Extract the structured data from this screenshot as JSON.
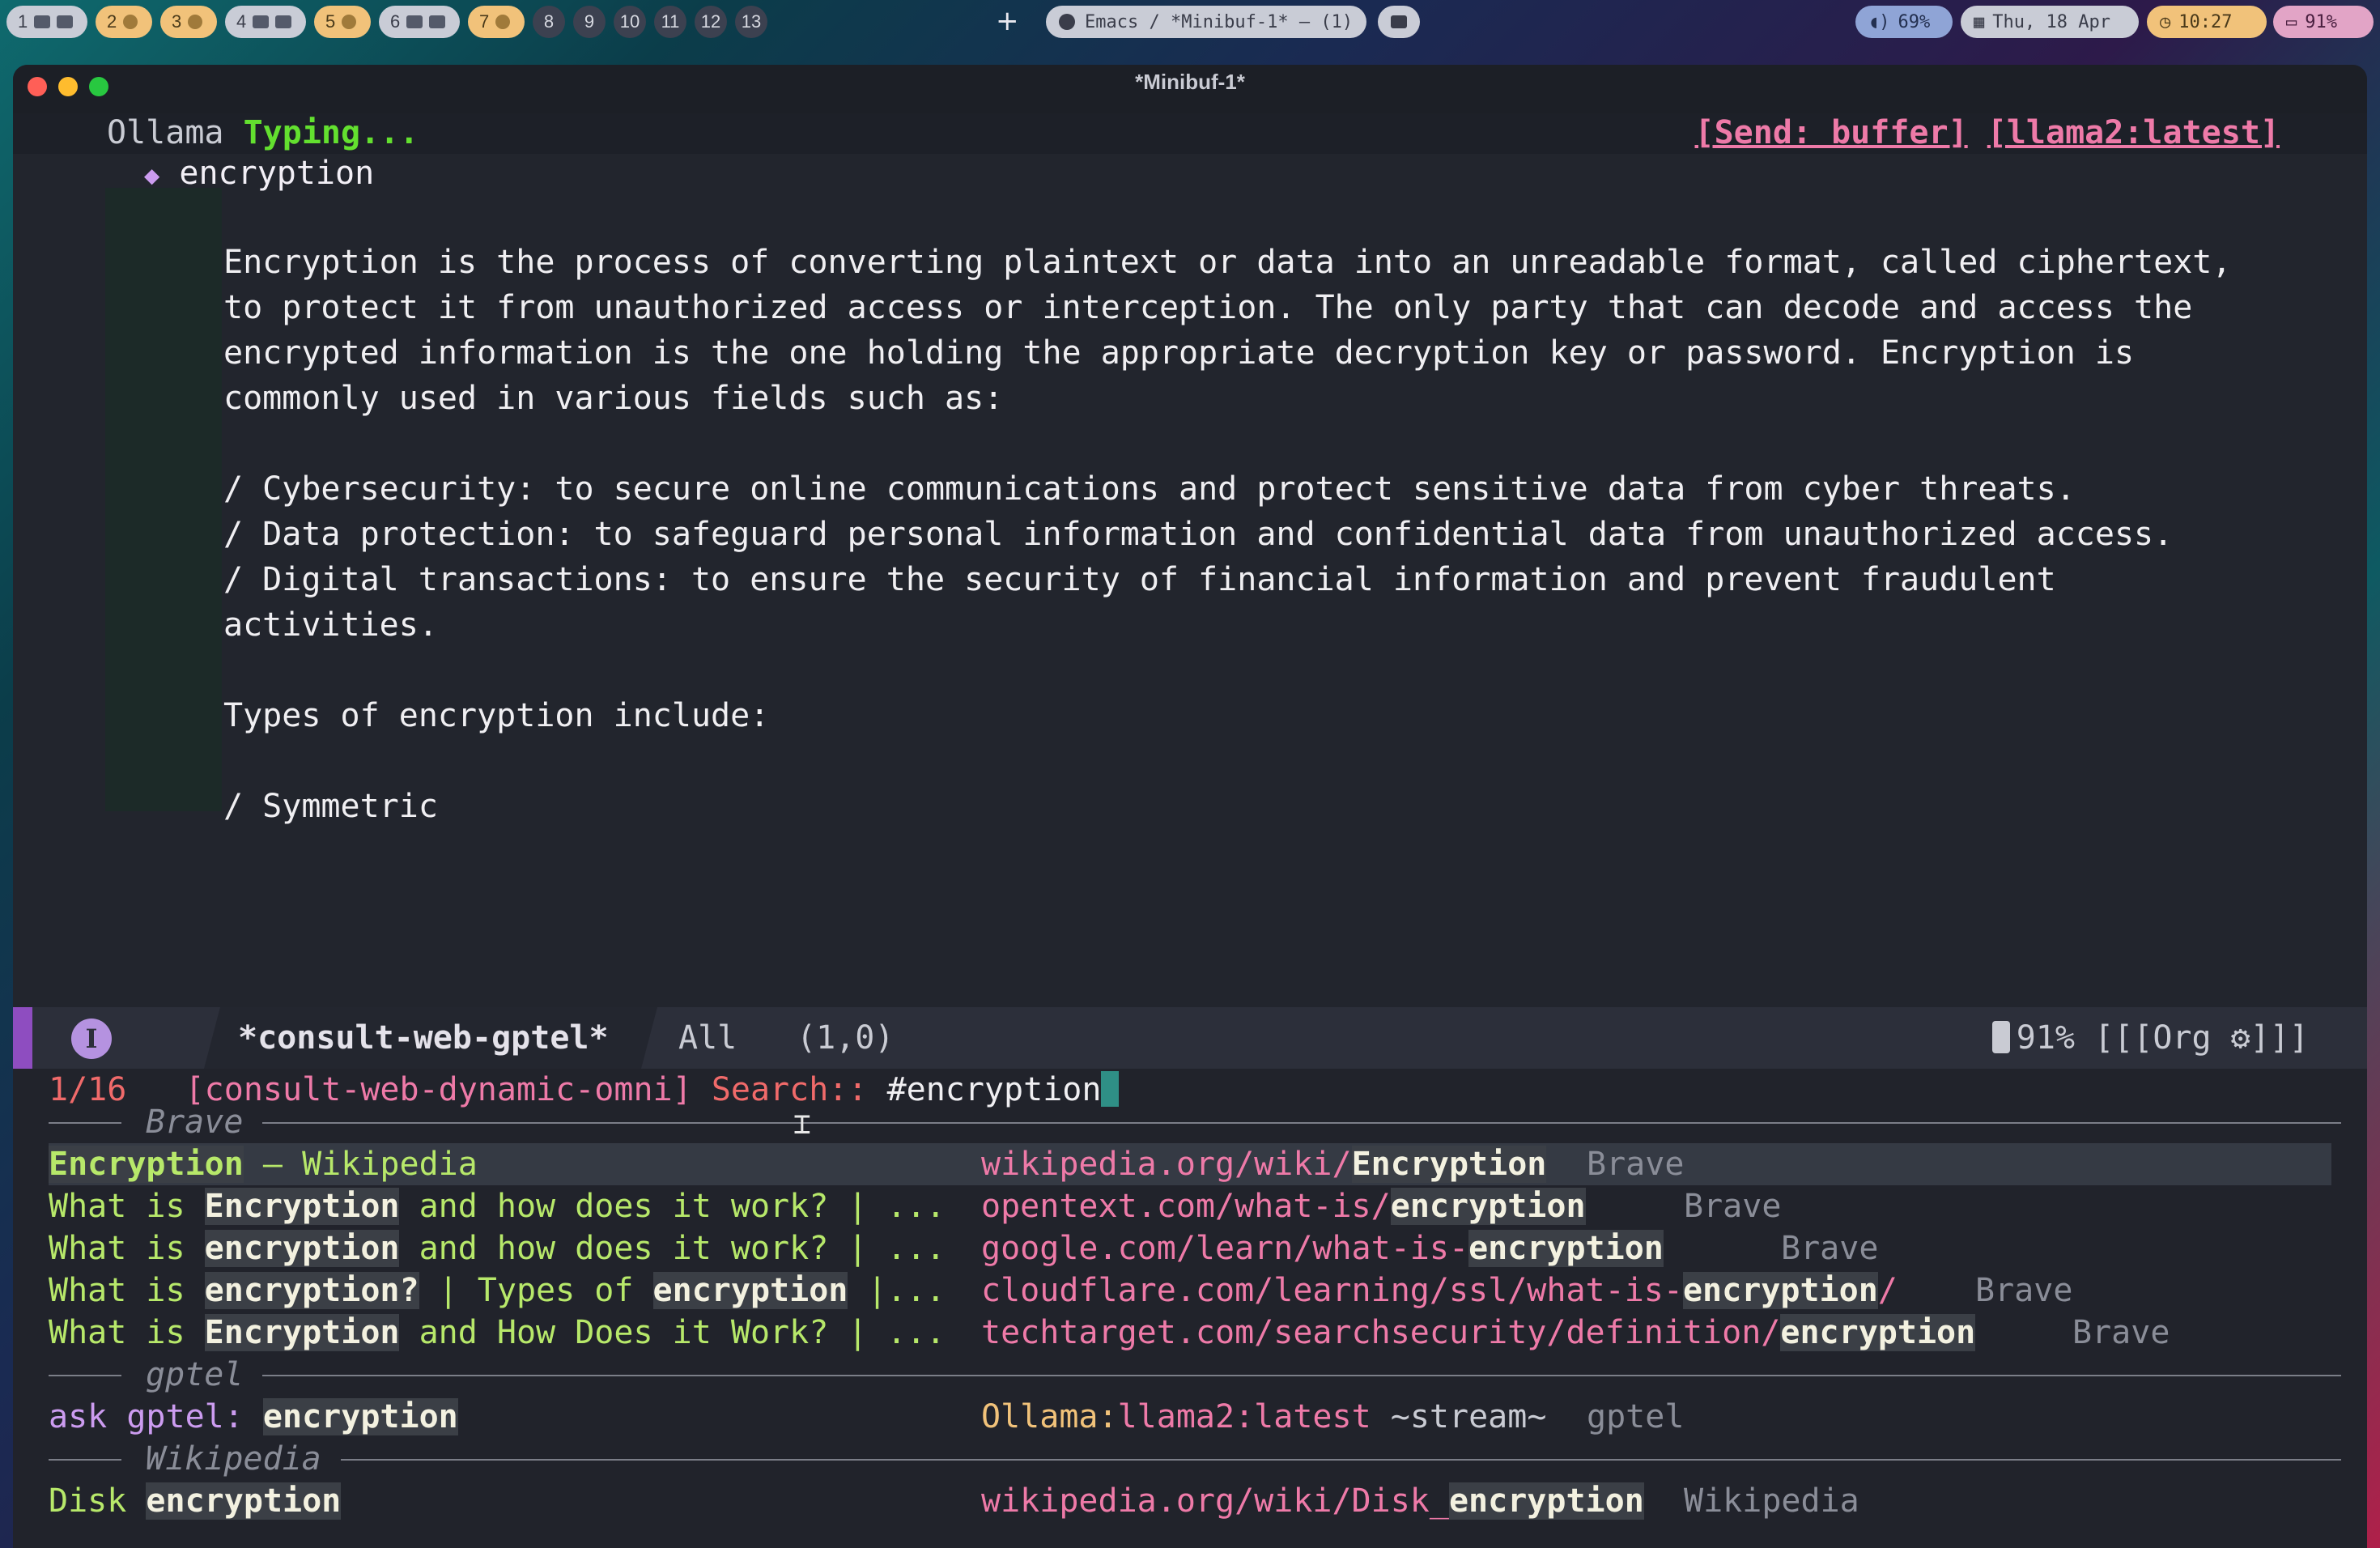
{
  "topbar": {
    "workspaces": [
      {
        "num": "1",
        "icons": [
          "terminal-icon",
          "window-icon"
        ],
        "active": false
      },
      {
        "num": "2",
        "icons": [
          "user-icon"
        ],
        "active": true
      },
      {
        "num": "3",
        "icons": [
          "window-icon"
        ],
        "active": true
      },
      {
        "num": "4",
        "icons": [
          "window-icon",
          "globe-icon"
        ],
        "active": false
      },
      {
        "num": "5",
        "icons": [
          "chat-icon"
        ],
        "active": true
      },
      {
        "num": "6",
        "icons": [
          "globe-icon",
          "window-icon"
        ],
        "active": false
      },
      {
        "num": "7",
        "icons": [
          "app-icon"
        ],
        "active": true
      },
      {
        "num": "8"
      },
      {
        "num": "9"
      },
      {
        "num": "10"
      },
      {
        "num": "11"
      },
      {
        "num": "12"
      },
      {
        "num": "13"
      }
    ],
    "add_label": "+",
    "window_title": "Emacs / *Minibuf-1* — (1)",
    "volume": "69%",
    "date": "Thu, 18 Apr",
    "time": "10:27",
    "battery": "91%"
  },
  "window": {
    "title": "*Minibuf-1*",
    "header": {
      "app": "Ollama",
      "status": "Typing...",
      "send": "[Send: buffer]",
      "model": "[llama2:latest]"
    },
    "heading": "encryption",
    "heading_bullet": "◆",
    "body": "Encryption is the process of converting plaintext or data into an unreadable format, called ciphertext,\nto protect it from unauthorized access or interception. The only party that can decode and access the\nencrypted information is the one holding the appropriate decryption key or password. Encryption is\ncommonly used in various fields such as:\n\n/ Cybersecurity: to secure online communications and protect sensitive data from cyber threats.\n/ Data protection: to safeguard personal information and confidential data from unauthorized access.\n/ Digital transactions: to ensure the security of financial information and prevent fraudulent\nactivities.\n\nTypes of encryption include:\n\n/ Symmetric"
  },
  "modeline": {
    "badge": "I",
    "buffer": "*consult-web-gptel*",
    "position": "All",
    "cursor": "(1,0)",
    "battery": "91%",
    "mode": "[[[Org ⚙]]]"
  },
  "minibuffer": {
    "count": "1/16",
    "command": "[consult-web-dynamic-omni]",
    "prompt": "Search::",
    "query": "#encryption",
    "groups": [
      {
        "name": "Brave",
        "items": [
          {
            "title_parts": [
              [
                "Encryption",
                "hlg"
              ],
              [
                " – Wikipedia",
                "g"
              ]
            ],
            "url_parts": [
              [
                "wikipedia.org/wiki/",
                "p"
              ],
              [
                "Encryption",
                "hl"
              ]
            ],
            "source": "Brave",
            "selected": true
          },
          {
            "title_parts": [
              [
                "What is ",
                "g"
              ],
              [
                "Encryption",
                "hl"
              ],
              [
                " and how does it work? | ...",
                "g"
              ]
            ],
            "url_parts": [
              [
                "opentext.com/what-is/",
                "p"
              ],
              [
                "encryption",
                "hl"
              ]
            ],
            "source": "Brave"
          },
          {
            "title_parts": [
              [
                "What is ",
                "g"
              ],
              [
                "encryption",
                "hl"
              ],
              [
                " and how does it work? | ...",
                "g"
              ]
            ],
            "url_parts": [
              [
                "google.com/learn/what-is-",
                "p"
              ],
              [
                "encryption",
                "hl"
              ]
            ],
            "source": "Brave"
          },
          {
            "title_parts": [
              [
                "What is ",
                "g"
              ],
              [
                "encryption?",
                "hl"
              ],
              [
                " | Types of ",
                "g"
              ],
              [
                "encryption",
                "hl"
              ],
              [
                " |...",
                "g"
              ]
            ],
            "url_parts": [
              [
                "cloudflare.com/learning/ssl/what-is-",
                "p"
              ],
              [
                "encryption",
                "hl"
              ],
              [
                "/",
                "p"
              ]
            ],
            "source": "Brave"
          },
          {
            "title_parts": [
              [
                "What is ",
                "g"
              ],
              [
                "Encryption",
                "hl"
              ],
              [
                " and How Does it Work? | ...",
                "g"
              ]
            ],
            "url_parts": [
              [
                "techtarget.com/searchsecurity/definition/",
                "p"
              ],
              [
                "encryption",
                "hl"
              ]
            ],
            "source": "Brave"
          }
        ]
      },
      {
        "name": "gptel",
        "items": [
          {
            "title_parts": [
              [
                "ask gptel: ",
                "v"
              ],
              [
                "encryption",
                "hl"
              ]
            ],
            "url_parts": [
              [
                "Ollama:",
                "y"
              ],
              [
                "llama2:latest",
                "p"
              ],
              [
                " ~stream~",
                "s"
              ]
            ],
            "source": "gptel"
          }
        ]
      },
      {
        "name": "Wikipedia",
        "items": [
          {
            "title_parts": [
              [
                "Disk ",
                "g"
              ],
              [
                "encryption",
                "hl"
              ]
            ],
            "url_parts": [
              [
                "wikipedia.org/wiki/Disk_",
                "p"
              ],
              [
                "encryption",
                "hl"
              ]
            ],
            "source": "Wikipedia"
          }
        ]
      }
    ]
  },
  "colors": {
    "accent": "#ee7aa8",
    "title_green": "#b7e86a",
    "typing_green": "#63e02f",
    "count_red": "#f06a6a",
    "modeline_purple": "#8e4dc0"
  }
}
